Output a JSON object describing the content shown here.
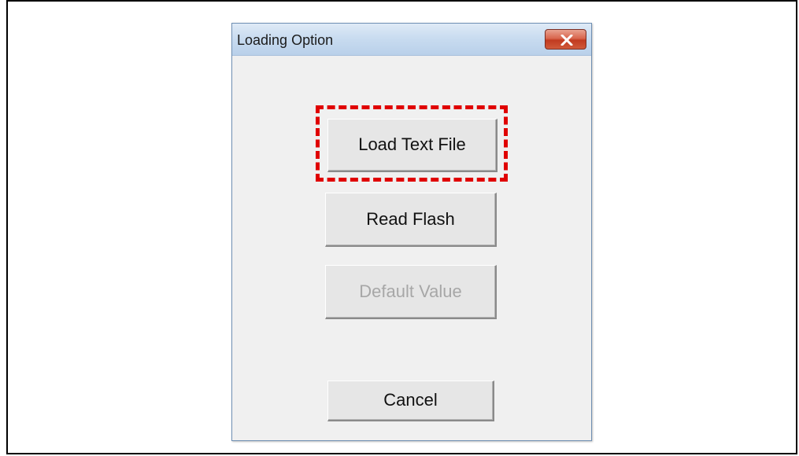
{
  "dialog": {
    "title": "Loading Option",
    "close_icon": "close-x-icon",
    "buttons": {
      "load_text_file": "Load Text File",
      "read_flash": "Read Flash",
      "default_value": "Default Value",
      "cancel": "Cancel"
    },
    "default_value_enabled": false
  },
  "annotation": {
    "highlight_color": "#e00000",
    "highlight_style": "dashed",
    "highlight_target": "Load Text File"
  },
  "colors": {
    "titlebar": "#c9dcf0",
    "dialog_bg": "#f0f0f0",
    "close_button": "#c13a20",
    "disabled_text": "#a7a7a7"
  }
}
